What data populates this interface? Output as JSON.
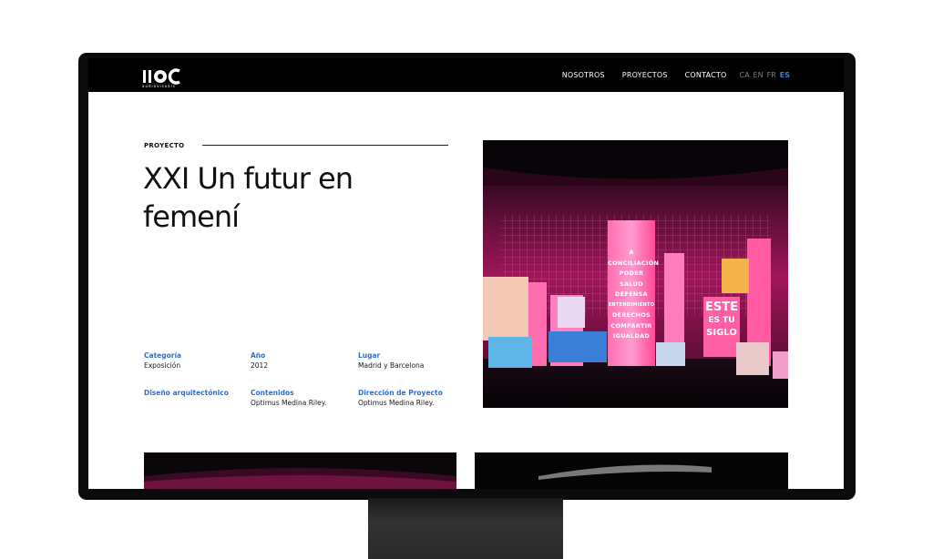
{
  "header": {
    "logo_text": "IIOC",
    "logo_subtitle": "audiovisuals",
    "nav": [
      "NOSOTROS",
      "PROYECTOS",
      "CONTACTO"
    ],
    "languages": [
      {
        "code": "CA",
        "active": false
      },
      {
        "code": "EN",
        "active": false
      },
      {
        "code": "FR",
        "active": false
      },
      {
        "code": "ES",
        "active": true
      }
    ]
  },
  "project": {
    "section_label": "PROYECTO",
    "title": "XXI Un futur en femení",
    "meta": [
      {
        "label": "Categoría",
        "value": "Exposición"
      },
      {
        "label": "Año",
        "value": "2012"
      },
      {
        "label": "Lugar",
        "value": "Madrid y Barcelona"
      },
      {
        "label": "Diseño arquitectónico",
        "value": ""
      },
      {
        "label": "Contenidos",
        "value": "Optimus Medina Riley."
      },
      {
        "label": "Dirección de Proyecto",
        "value": "Optimus Medina Riley."
      }
    ]
  },
  "hero_image": {
    "center_text": [
      "A",
      "CONCILIACIÓN",
      "PODER",
      "SALUD",
      "DEFENSA",
      "ENTENDIMIENTO",
      "DERECHOS",
      "COMPARTIR",
      "IGUALDAD"
    ],
    "right_text": [
      "ESTE",
      "ES TU",
      "SIGLO"
    ]
  },
  "colors": {
    "accent": "#3b7de0",
    "label_blue": "#2f6fd0",
    "header_bg": "#000000",
    "pink": "#ff3d8c"
  }
}
